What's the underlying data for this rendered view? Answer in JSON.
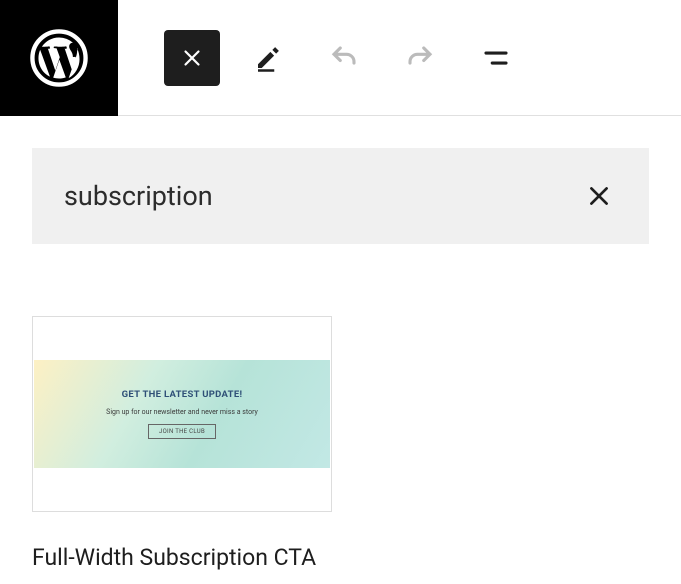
{
  "toolbar": {
    "close_button": "Close",
    "edit_button": "Edit",
    "undo_button": "Undo",
    "redo_button": "Redo",
    "details_button": "Document Overview"
  },
  "search": {
    "value": "subscription",
    "clear_label": "Clear search"
  },
  "results": [
    {
      "label": "Full-Width Subscription CTA",
      "preview": {
        "title": "GET THE LATEST UPDATE!",
        "subtitle": "Sign up for our newsletter and never miss a story",
        "button": "JOIN THE CLUB"
      }
    }
  ]
}
